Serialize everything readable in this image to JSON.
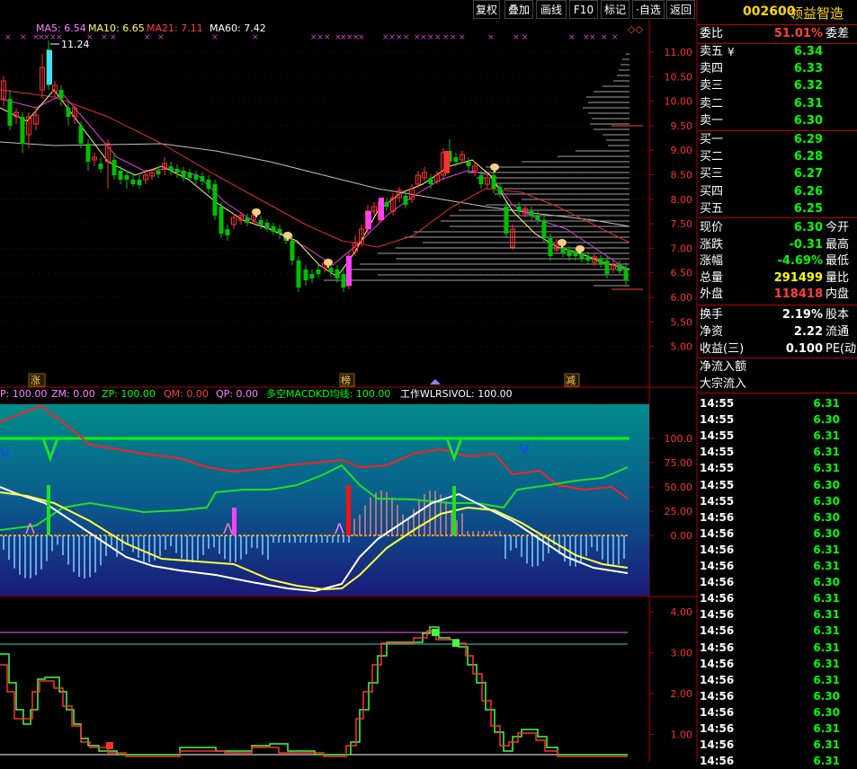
{
  "toolbar": {
    "buttons": [
      "复权",
      "叠加",
      "画线",
      "F10",
      "标记",
      "·自选",
      "返回"
    ]
  },
  "stock": {
    "code": "002600",
    "name": "领益智造"
  },
  "ma_legend": {
    "ma5": "MA5: 6.54",
    "ma10": "MA10: 6.65",
    "ma21": "MA21: 7.11",
    "ma60": "MA60: 7.42",
    "high_mark": "11.24"
  },
  "price_axis": [
    "11.00",
    "10.50",
    "10.00",
    "9.50",
    "9.00",
    "8.50",
    "8.00",
    "7.50",
    "7.00",
    "6.50",
    "6.00",
    "5.50",
    "5.00"
  ],
  "event_labels": {
    "e1": "涨",
    "e2": "榜",
    "e3": "减"
  },
  "indicator_legend": {
    "p": "P: 100.00",
    "zm": "ZM: 0.00",
    "zp": "ZP: 100.00",
    "qm": "QM: 0.00",
    "qp": "QP: 0.00",
    "dk": "多空MACDKD均线: 100.00",
    "wl": "工作WLRSIVOL: 100.00"
  },
  "indicator_axis": [
    "100.0",
    "75.00",
    "50.00",
    "25.00",
    "0.00"
  ],
  "bottom_axis": [
    "4.00",
    "3.00",
    "2.00",
    "1.00"
  ],
  "quote": {
    "weibi_label": "委比",
    "weibi": "51.01%",
    "weicha_label": "委差",
    "asks": [
      {
        "label": "卖五",
        "price": "6.34",
        "extra": "¥"
      },
      {
        "label": "卖四",
        "price": "6.33",
        "extra": ""
      },
      {
        "label": "卖三",
        "price": "6.32",
        "extra": ""
      },
      {
        "label": "卖二",
        "price": "6.31",
        "extra": ""
      },
      {
        "label": "卖一",
        "price": "6.30",
        "extra": ""
      }
    ],
    "bids": [
      {
        "label": "买一",
        "price": "6.29"
      },
      {
        "label": "买二",
        "price": "6.28"
      },
      {
        "label": "买三",
        "price": "6.27"
      },
      {
        "label": "买四",
        "price": "6.26"
      },
      {
        "label": "买五",
        "price": "6.25"
      }
    ],
    "stats1": [
      {
        "label": "现价",
        "value": "6.30",
        "color": "#00ff00",
        "label2": "今开"
      },
      {
        "label": "涨跌",
        "value": "-0.31",
        "color": "#00ff00",
        "label2": "最高"
      },
      {
        "label": "涨幅",
        "value": "-4.69%",
        "color": "#00ff00",
        "label2": "最低"
      },
      {
        "label": "总量",
        "value": "291499",
        "color": "#ffff00",
        "label2": "量比"
      },
      {
        "label": "外盘",
        "value": "118418",
        "color": "#ff4040",
        "label2": "内盘"
      }
    ],
    "stats2": [
      {
        "label": "换手",
        "value": "2.19%",
        "label2": "股本"
      },
      {
        "label": "净资",
        "value": "2.22",
        "label2": "流通"
      },
      {
        "label": "收益(三)",
        "value": "0.100",
        "label2": "PE(动"
      }
    ],
    "flow": [
      "净流入额",
      "大宗流入"
    ]
  },
  "ticks": [
    {
      "t": "14:55",
      "p": "6.31"
    },
    {
      "t": "14:55",
      "p": "6.30"
    },
    {
      "t": "14:55",
      "p": "6.31"
    },
    {
      "t": "14:55",
      "p": "6.31"
    },
    {
      "t": "14:55",
      "p": "6.31"
    },
    {
      "t": "14:55",
      "p": "6.30"
    },
    {
      "t": "14:55",
      "p": "6.30"
    },
    {
      "t": "14:56",
      "p": "6.30"
    },
    {
      "t": "14:56",
      "p": "6.30"
    },
    {
      "t": "14:56",
      "p": "6.31"
    },
    {
      "t": "14:56",
      "p": "6.31"
    },
    {
      "t": "14:56",
      "p": "6.30"
    },
    {
      "t": "14:56",
      "p": "6.31"
    },
    {
      "t": "14:56",
      "p": "6.31"
    },
    {
      "t": "14:56",
      "p": "6.31"
    },
    {
      "t": "14:56",
      "p": "6.31"
    },
    {
      "t": "14:56",
      "p": "6.31"
    },
    {
      "t": "14:56",
      "p": "6.31"
    },
    {
      "t": "14:56",
      "p": "6.30"
    },
    {
      "t": "14:56",
      "p": "6.30"
    },
    {
      "t": "14:56",
      "p": "6.31"
    },
    {
      "t": "14:56",
      "p": "6.31"
    },
    {
      "t": "14:56",
      "p": "6.31"
    }
  ],
  "colors": {
    "up": "#ff3030",
    "down": "#00ff00",
    "accent": "#ffd700",
    "border": "#b00000"
  }
}
